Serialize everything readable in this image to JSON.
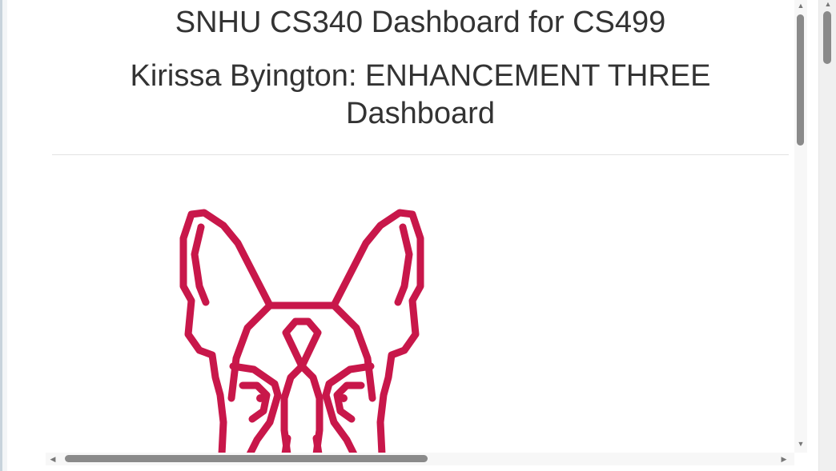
{
  "header": {
    "title": "SNHU CS340 Dashboard for CS499",
    "subtitle_line1": "Kirissa Byington: ENHANCEMENT THREE",
    "subtitle_line2": "Dashboard"
  },
  "logo": {
    "icon": "dog-head-logo-icon",
    "color": "#c8174a"
  },
  "scrollbars": {
    "up_arrow": "▲",
    "down_arrow": "▼",
    "left_arrow": "◀",
    "right_arrow": "▶"
  },
  "colors": {
    "text": "#333333",
    "divider": "#e2e2e2",
    "scroll_thumb": "#8a8a8a"
  }
}
